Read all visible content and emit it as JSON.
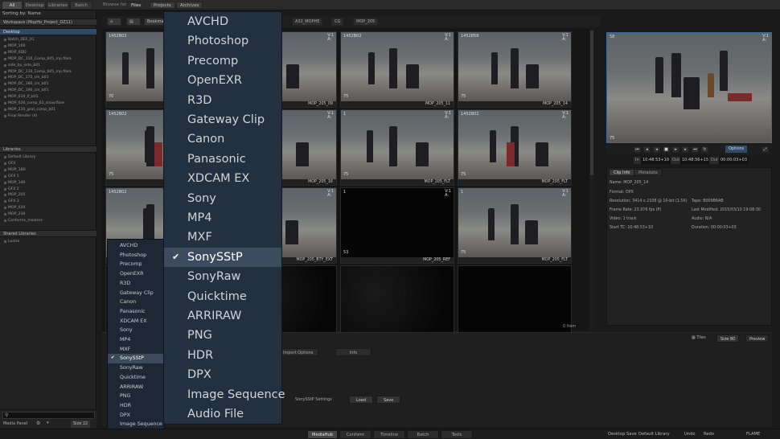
{
  "top_tabs": [
    "All",
    "Desktop",
    "Libraries",
    "Batch"
  ],
  "browse": {
    "label": "Browse for:",
    "options": [
      "Files",
      "Projects",
      "Archives"
    ]
  },
  "left": {
    "sort_label": "Sorting by: Name",
    "workspace": "Workspace (MopHo_Project_DZ11)",
    "desktop": "Desktop",
    "desktop_items": [
      "Batch_DEF_01",
      "MOP_100",
      "MOP_0DD",
      "MOP_DC_110_Comp_b05_mp.flare",
      "side_by_side_b01",
      "MOP_DC_110_Comp_b05_mp.flare",
      "MOP_DC_175_cln_b01",
      "MOP_DC_180_cln_b01",
      "MOP_DC_190_cln_b01",
      "MOP_010_lf_b01",
      "MOP_020_comp_61_snow.flare",
      "MOP_220_grat_comp_b01",
      "Final Render (4)"
    ],
    "libraries_head": "Libraries",
    "library_items": [
      "Default Library",
      "GFX",
      "MOP_1B0",
      "GFX 1",
      "MOP_140",
      "GFX 2",
      "MOP_205",
      "GFX 3",
      "MOP_020",
      "MOP_230",
      "Conforms_masters"
    ],
    "shared_head": "Shared Libraries",
    "shared_items": [
      "Lustre"
    ],
    "footer_panel": "Media Panel",
    "footer_size": "Size 22"
  },
  "pathbar": {
    "bookmark": "Bookma",
    "crumbs": [
      "A32_MOPHE",
      "CG",
      "MOP_205"
    ]
  },
  "grid": {
    "cells": [
      {
        "tc": "1452B02",
        "vr": "V:1\nA:",
        "num": "70",
        "name": "",
        "kind": "scene"
      },
      {
        "tc": "1452B02",
        "vr": "V:1\nA:",
        "num": "75",
        "name": "MOP_205_09",
        "kind": "scene"
      },
      {
        "tc": "1452B02",
        "vr": "V:1\nA:",
        "num": "75",
        "name": "MOP_205_11",
        "kind": "scene"
      },
      {
        "tc": "1452859",
        "vr": "V:1\nA:",
        "num": "75",
        "name": "MOP_205_14",
        "kind": "scene"
      },
      {
        "tc": "1452B02",
        "vr": "V:1\nA:",
        "num": "75",
        "name": "",
        "kind": "scene"
      },
      {
        "tc": "1452B02",
        "vr": "V:1\nA:",
        "num": "75",
        "name": "MOP_205_16",
        "kind": "scene"
      },
      {
        "tc": "1",
        "vr": "V:1\nA:",
        "num": "75",
        "name": "MOP_205_FLT",
        "kind": "scene"
      },
      {
        "tc": "1452B02",
        "vr": "V:1\nA:",
        "num": "75",
        "name": "MOP_205_FLT",
        "kind": "scene"
      },
      {
        "tc": "1452B02",
        "vr": "V:1\nA:",
        "num": "",
        "name": "",
        "kind": "scene"
      },
      {
        "tc": "1",
        "vr": "V:1\nA:",
        "num": "",
        "name": "MOP_205_BTY_EXT",
        "kind": "scene"
      },
      {
        "tc": "1",
        "vr": "V:1\nA:",
        "num": "53",
        "name": "MOP_205_REF",
        "kind": "dark"
      },
      {
        "tc": "1",
        "vr": "V:1\nA:",
        "num": "75",
        "name": "MOP_205_FLT",
        "kind": "scene"
      },
      {
        "tc": "",
        "vr": "",
        "num": "",
        "name": "",
        "kind": "noise"
      },
      {
        "tc": "",
        "vr": "",
        "num": "",
        "name": "",
        "kind": "noise"
      },
      {
        "tc": "",
        "vr": "",
        "num": "",
        "name": "",
        "kind": "noise"
      },
      {
        "tc": "",
        "vr": "",
        "num": "",
        "name": "",
        "kind": "dark"
      }
    ],
    "count": "0 Item"
  },
  "viewer": {
    "tc_top": "58",
    "vr": "V:1\nA:",
    "tc_bot": "75",
    "options": "Options",
    "in_label": "In",
    "in_val": "10:48:53+10",
    "out_label": "Out",
    "out_val": "10:48:56+15",
    "dur_label": "Dur",
    "dur_val": "00:00:03+03"
  },
  "clipinfo": {
    "tabs": [
      "Clip Info",
      "Metadata"
    ],
    "name": "Name: MOP_205_14",
    "format": "Format: DPX",
    "resolution": "Resolution: 3414 x 2108 @ 10-bit (1.56)",
    "tape": "Tape: B009B6AB",
    "frame_rate": "Frame Rate: 23.976 fps (P)",
    "modified": "Last Modified: 2015/03/10 19:08:30",
    "video": "Video: 1 track",
    "audio": "Audio: N/A",
    "start_tc": "Start TC: 10:48:53+10",
    "duration": "Duration: 00:00:03+03"
  },
  "bottom_panel": {
    "tabs": [
      "Import Options",
      "Info"
    ],
    "settings_label": "SonySStP Settings",
    "load": "Load",
    "save": "Save",
    "tiles": "Tiles",
    "size": "Size 80",
    "preview": "Preview"
  },
  "formats": [
    "AVCHD",
    "Photoshop",
    "Precomp",
    "OpenEXR",
    "R3D",
    "Gateway Clip",
    "Canon",
    "Panasonic",
    "XDCAM EX",
    "Sony",
    "MP4",
    "MXF",
    "SonySStP",
    "SonyRaw",
    "Quicktime",
    "ARRIRAW",
    "PNG",
    "HDR",
    "DPX",
    "Image Sequence",
    "Audio File"
  ],
  "selected_format": "SonySStP",
  "check_mark": "✔",
  "statusbar": {
    "tabs": [
      "MediaHub",
      "Conform",
      "Timeline",
      "Batch",
      "Tools"
    ],
    "desktop": "Desktop",
    "save": "Save",
    "library": "Default Library",
    "undo": "Undo",
    "redo": "Redo",
    "brand": "FLAME"
  },
  "colors": {
    "accent": "#3b4f68",
    "menu_bg": "#223040",
    "menu_sel": "#3d4b5e"
  }
}
